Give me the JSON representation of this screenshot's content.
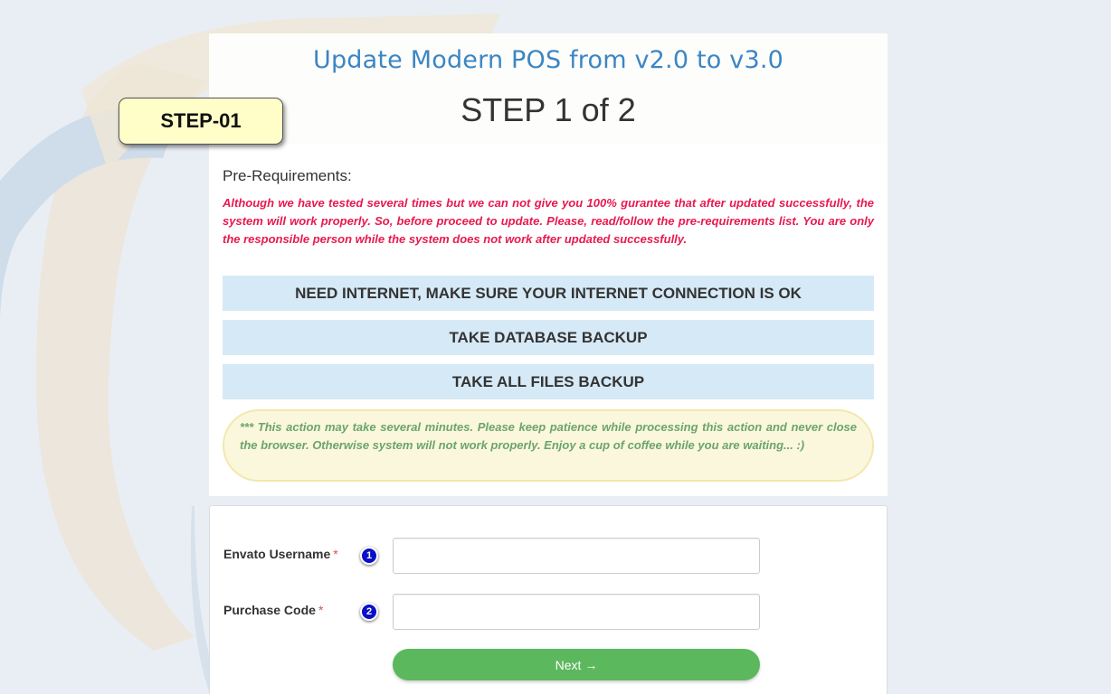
{
  "header": {
    "title": "Update Modern POS from v2.0 to v3.0",
    "step_title": "STEP 1 of 2",
    "step_badge": "STEP-01"
  },
  "prereq": {
    "label": "Pre-Requirements:",
    "warning": "Although we have tested several times but we can not give you 100% gurantee that after updated successfully, the system will work properly. So, before proceed to update. Please, read/follow the pre-requirements list. You are only the responsible person while the system does not work after updated successfully.",
    "items": [
      "NEED INTERNET, MAKE SURE YOUR INTERNET CONNECTION IS OK",
      "TAKE DATABASE BACKUP",
      "TAKE ALL FILES BACKUP"
    ],
    "notice": "*** This action may take several minutes. Please keep patience while processing this action and never close the browser. Otherwise system will not work properly. Enjoy a cup of coffee while you are waiting... :)"
  },
  "form": {
    "username_label": "Envato Username",
    "purchase_label": "Purchase Code",
    "required_mark": "*",
    "step_numbers": [
      "1",
      "2"
    ],
    "username_value": "",
    "purchase_value": "",
    "next_label": "Next →"
  },
  "colors": {
    "title": "#3b86c4",
    "warning": "#e8194f",
    "requirement_bg": "#d6e9f6",
    "notice_text": "#6aa56b",
    "notice_bg": "#fbf7dc",
    "badge_bg": "#fffec8",
    "next_button": "#5cb85c",
    "number_icon": "#0a10c8"
  }
}
